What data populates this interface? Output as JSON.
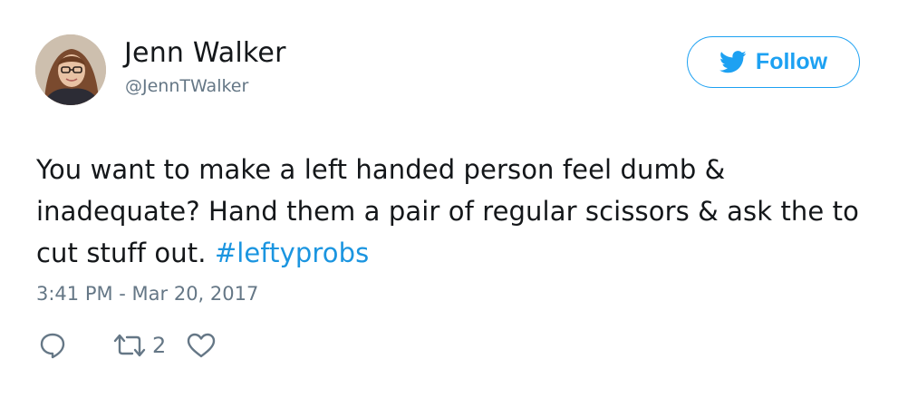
{
  "author": {
    "name": "Jenn Walker",
    "handle": "@JennTWalker"
  },
  "follow_button": {
    "label": "Follow",
    "icon": "twitter-bird-icon"
  },
  "tweet": {
    "text": "You want to make a left handed person feel dumb & inadequate? Hand them a pair of regular scissors & ask the to cut stuff out.",
    "hashtag": "#leftyprobs",
    "timestamp": "3:41 PM - Mar 20, 2017"
  },
  "actions": {
    "reply_icon": "reply-icon",
    "retweet_icon": "retweet-icon",
    "retweet_count": "2",
    "like_icon": "heart-icon"
  },
  "colors": {
    "accent": "#1da1f2",
    "hashtag": "#1b95e0",
    "text": "#14171a",
    "secondary": "#657786"
  }
}
